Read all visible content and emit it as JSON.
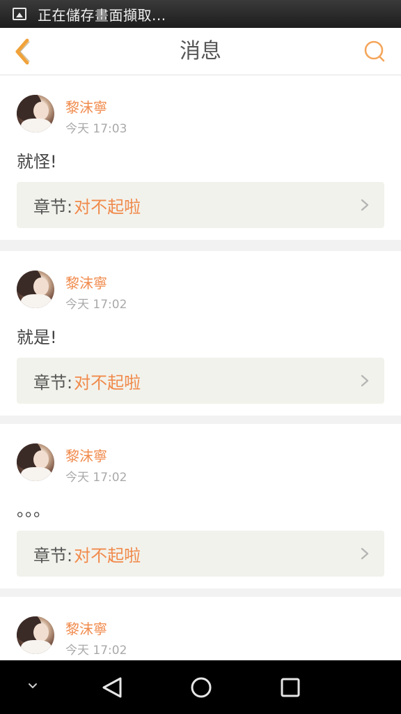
{
  "statusbar": {
    "icon": "screenshot-icon",
    "text": "正在儲存畫面擷取..."
  },
  "header": {
    "title": "消息",
    "back_icon": "chevron-left-icon",
    "search_icon": "search-icon"
  },
  "colors": {
    "accent": "#f08a4b",
    "chapter_bg": "#f2f2ec",
    "page_bg": "#f2f2f2"
  },
  "messages": [
    {
      "name": "黎沫寧",
      "time": "今天 17:03",
      "content": "就怪!",
      "chapter_label": "章节:",
      "chapter_title": "对不起啦"
    },
    {
      "name": "黎沫寧",
      "time": "今天 17:02",
      "content": "就是!",
      "chapter_label": "章节:",
      "chapter_title": "对不起啦"
    },
    {
      "name": "黎沫寧",
      "time": "今天 17:02",
      "content": "。。。",
      "chapter_label": "章节:",
      "chapter_title": "对不起啦"
    },
    {
      "name": "黎沫寧",
      "time": "今天 17:02"
    }
  ],
  "navbar": {
    "items": [
      "chevron-down-icon",
      "back-triangle-icon",
      "home-circle-icon",
      "recents-square-icon"
    ]
  }
}
